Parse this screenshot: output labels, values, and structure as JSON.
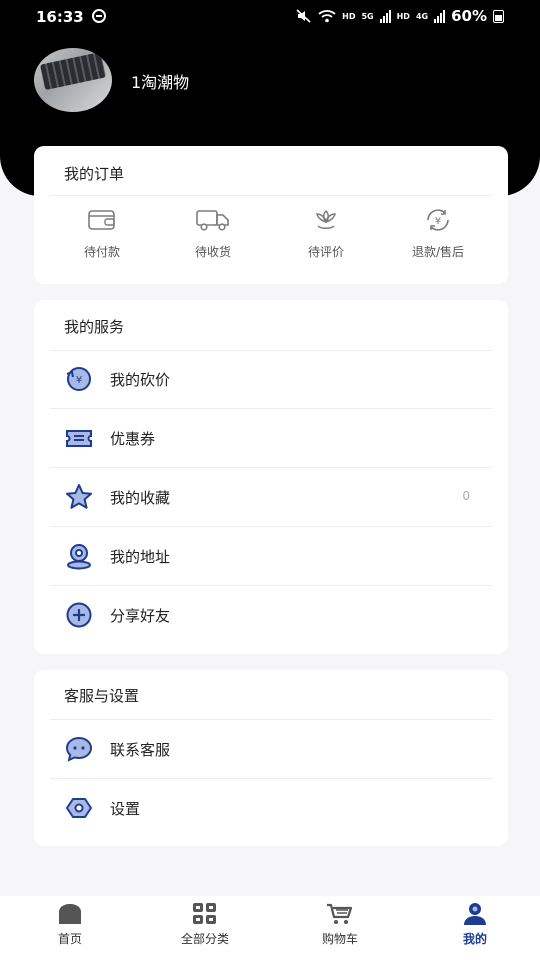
{
  "status_bar": {
    "time": "16:33",
    "net_hd1": "HD",
    "net_5g": "5G",
    "net_hd2": "HD",
    "net_4g": "4G",
    "battery": "60%"
  },
  "profile": {
    "username": "1淘潮物"
  },
  "orders": {
    "title": "我的订单",
    "items": [
      {
        "label": "待付款",
        "icon": "wallet-icon"
      },
      {
        "label": "待收货",
        "icon": "truck-icon"
      },
      {
        "label": "待评价",
        "icon": "flower-icon"
      },
      {
        "label": "退款/售后",
        "icon": "refund-icon"
      }
    ]
  },
  "services": {
    "title": "我的服务",
    "items": [
      {
        "label": "我的砍价",
        "icon": "bargain-icon"
      },
      {
        "label": "优惠券",
        "icon": "coupon-icon"
      },
      {
        "label": "我的收藏",
        "icon": "star-icon",
        "count": "0"
      },
      {
        "label": "我的地址",
        "icon": "location-icon"
      },
      {
        "label": "分享好友",
        "icon": "share-plus-icon"
      }
    ]
  },
  "support": {
    "title": "客服与设置",
    "items": [
      {
        "label": "联系客服",
        "icon": "chat-icon"
      },
      {
        "label": "设置",
        "icon": "settings-icon"
      }
    ]
  },
  "tabbar": {
    "items": [
      {
        "label": "首页",
        "icon": "home-icon"
      },
      {
        "label": "全部分类",
        "icon": "grid-icon"
      },
      {
        "label": "购物车",
        "icon": "cart-icon"
      },
      {
        "label": "我的",
        "icon": "user-icon",
        "active": true
      }
    ]
  },
  "colors": {
    "accent": "#1d3d8f",
    "icon_fill": "#a9b8e6",
    "header": "#000000"
  }
}
